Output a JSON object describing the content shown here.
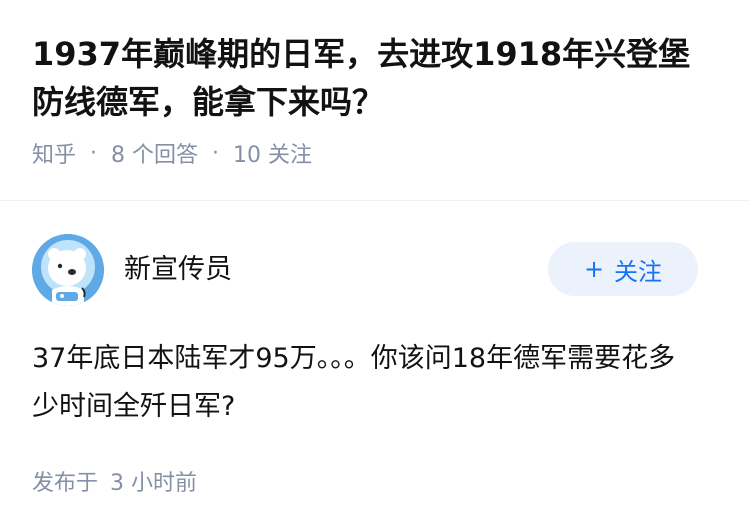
{
  "question": {
    "title": "1937年巅峰期的日军，去进攻1918年兴登堡防线德军，能拿下来吗？",
    "source": "知乎",
    "answers_count": "8 个回答",
    "followers_count": "10 关注"
  },
  "answer": {
    "author": {
      "name": "新宣传员",
      "avatar_icon": "astronaut-bear-avatar-icon"
    },
    "follow_button": {
      "icon": "+",
      "label": "关注"
    },
    "content": "37年底日本陆军才95万。。。你该问18年德军需要花多少时间全歼日军?",
    "footer": {
      "published_label": "发布于",
      "time": "3 小时前"
    }
  },
  "colors": {
    "text": "#121212",
    "meta": "#8590a6",
    "accent": "#1772f6",
    "button_bg": "#ebf2fc",
    "avatar_bg": "#5ea9e6"
  }
}
